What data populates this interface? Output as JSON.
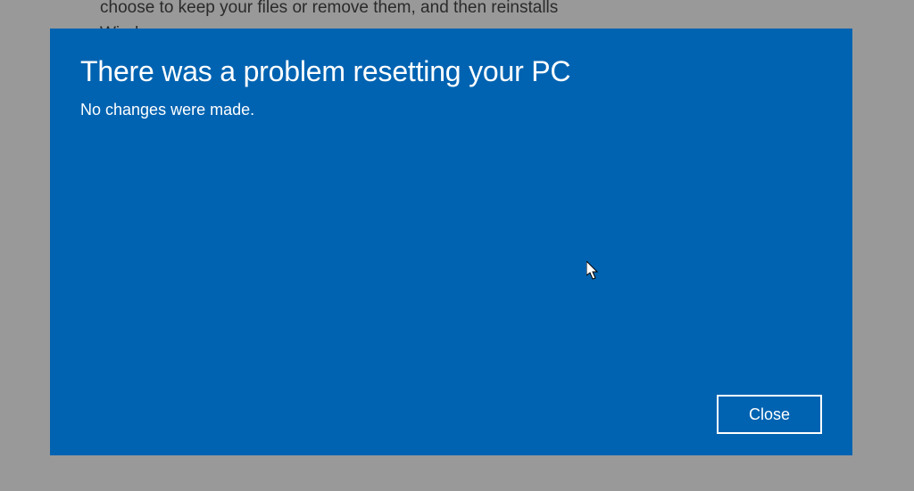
{
  "background": {
    "text_line1": "choose to keep your files or remove them, and then reinstalls",
    "text_line2": "Windows."
  },
  "dialog": {
    "title": "There was a problem resetting your PC",
    "body": "No changes were made.",
    "close_label": "Close"
  },
  "colors": {
    "background": "#999999",
    "dialog_bg": "#0063B1",
    "dialog_text": "#ffffff",
    "button_border": "#ffffff"
  }
}
